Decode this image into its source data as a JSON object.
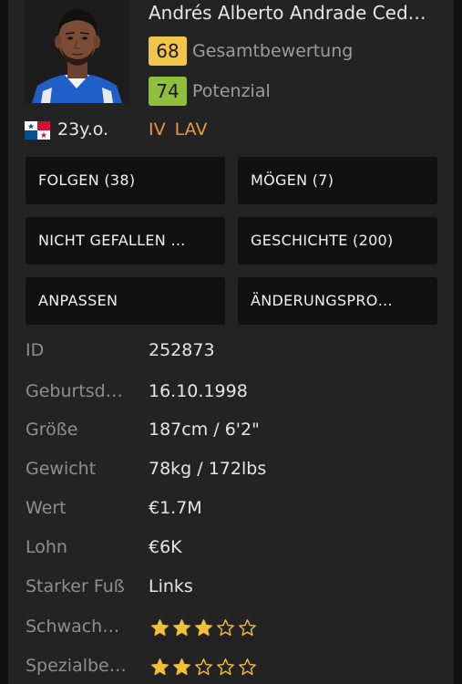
{
  "player": {
    "name": "Andrés Alberto Andrade Ced…",
    "overall": "68",
    "overall_label": "Gesamtbewertung",
    "potential": "74",
    "potential_label": "Potenzial",
    "age": "23y.o.",
    "positions": "IV  LAV",
    "nationality_icon": "panama-flag-icon",
    "photo_icon": "player-photo"
  },
  "colors": {
    "overall_badge": "#f1c54a",
    "potential_badge": "#8fbf3c",
    "positions": "#e59b3d",
    "star": "#f2c037"
  },
  "buttons": {
    "follow": "FOLGEN (38)",
    "like": "MÖGEN (7)",
    "dislike": "NICHT GEFALLEN …",
    "history": "GESCHICHTE (200)",
    "customize": "ANPASSEN",
    "changes": "ÄNDERUNGSPRO…"
  },
  "info": {
    "id_label": "ID",
    "id_value": "252873",
    "birth_label": "Geburtsd…",
    "birth_value": "16.10.1998",
    "height_label": "Größe",
    "height_value": "187cm / 6'2\"",
    "weight_label": "Gewicht",
    "weight_value": "78kg / 172lbs",
    "value_label": "Wert",
    "value_value": "€1.7M",
    "wage_label": "Lohn",
    "wage_value": "€6K",
    "foot_label": "Starker Fuß",
    "foot_value": "Links",
    "weak_foot_label": "Schwach…",
    "weak_foot_stars": 3,
    "skill_moves_label": "Spezialbe…",
    "skill_moves_stars": 2,
    "stars_max": 5
  }
}
